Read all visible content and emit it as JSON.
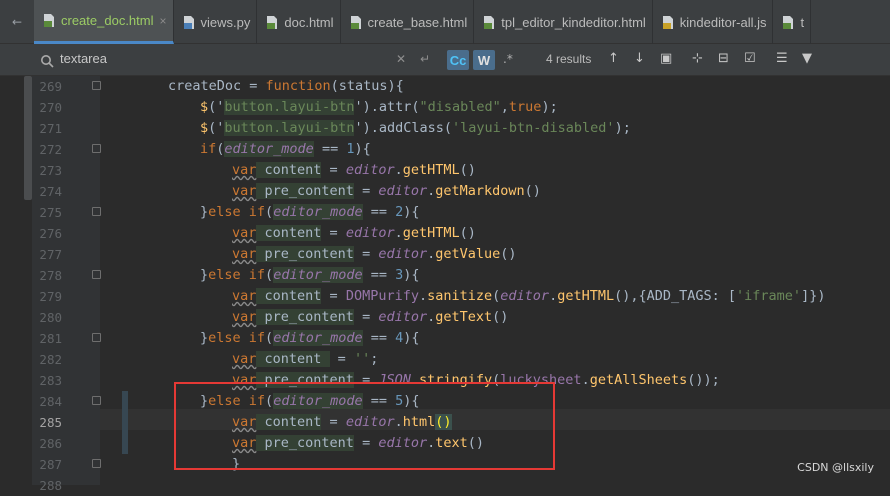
{
  "tabs": [
    {
      "label": "create_doc.html",
      "type": "html",
      "active": true,
      "closable": true
    },
    {
      "label": "views.py",
      "type": "py",
      "active": false,
      "closable": false
    },
    {
      "label": "doc.html",
      "type": "html",
      "active": false,
      "closable": false
    },
    {
      "label": "create_base.html",
      "type": "html",
      "active": false,
      "closable": false
    },
    {
      "label": "tpl_editor_kindeditor.html",
      "type": "html",
      "active": false,
      "closable": false
    },
    {
      "label": "kindeditor-all.js",
      "type": "js",
      "active": false,
      "closable": false
    },
    {
      "label": "t",
      "type": "html",
      "active": false,
      "closable": false
    }
  ],
  "find": {
    "query": "textarea",
    "match_case_label": "Cc",
    "words_label": "W",
    "regex_label": ".*",
    "results": "4 results"
  },
  "lines": [
    {
      "n": "269",
      "d": 0,
      "fold": true
    },
    {
      "n": "270",
      "d": 1
    },
    {
      "n": "271",
      "d": 1
    },
    {
      "n": "272",
      "d": 1,
      "fold": true
    },
    {
      "n": "273",
      "d": 2
    },
    {
      "n": "274",
      "d": 2
    },
    {
      "n": "275",
      "d": 1,
      "fold": true
    },
    {
      "n": "276",
      "d": 2
    },
    {
      "n": "277",
      "d": 2
    },
    {
      "n": "278",
      "d": 1,
      "fold": true
    },
    {
      "n": "279",
      "d": 2
    },
    {
      "n": "280",
      "d": 2
    },
    {
      "n": "281",
      "d": 1,
      "fold": true
    },
    {
      "n": "282",
      "d": 2
    },
    {
      "n": "283",
      "d": 2
    },
    {
      "n": "284",
      "d": 1,
      "fold": true,
      "changed": true
    },
    {
      "n": "285",
      "d": 2,
      "current": true,
      "changed": true
    },
    {
      "n": "286",
      "d": 2,
      "changed": true
    },
    {
      "n": "287",
      "d": 1,
      "fold": true
    },
    {
      "n": "288",
      "d": 1
    }
  ],
  "code": {
    "l269": {
      "id": "createDoc",
      "op": " = ",
      "kw": "function",
      "rest": "(status){"
    },
    "l270": {
      "jq": "$",
      "open": "('",
      "sel": "button.layui-btn",
      "close": "')",
      "call": ".attr(",
      "s1": "\"disabled\"",
      "comma": ",",
      "kw": "true",
      "end": ");"
    },
    "l271": {
      "jq": "$",
      "open": "('",
      "sel": "button.layui-btn",
      "close": "')",
      "call": ".addClass(",
      "s1": "'layui-btn-disabled'",
      "end": ");"
    },
    "l272": {
      "kw": "if",
      "open": "(",
      "v": "editor_mode",
      "op": " == ",
      "n": "1",
      "close": "){"
    },
    "l273": {
      "kw": "var",
      "id": " content",
      "op": " = ",
      "v": "editor",
      "dot": ".",
      "m": "getHTML",
      "end": "()"
    },
    "l274": {
      "kw": "var",
      "id": " pre_content",
      "op": " = ",
      "v": "editor",
      "dot": ".",
      "m": "getMarkdown",
      "end": "()"
    },
    "l275": {
      "pre": "}",
      "kw": "else if",
      "open": "(",
      "v": "editor_mode",
      "op": " == ",
      "n": "2",
      "close": "){"
    },
    "l276": {
      "kw": "var",
      "id": " content",
      "op": " = ",
      "v": "editor",
      "dot": ".",
      "m": "getHTML",
      "end": "()"
    },
    "l277": {
      "kw": "var",
      "id": " pre_content",
      "op": " = ",
      "v": "editor",
      "dot": ".",
      "m": "getValue",
      "end": "()"
    },
    "l278": {
      "pre": "}",
      "kw": "else if",
      "open": "(",
      "v": "editor_mode",
      "op": " == ",
      "n": "3",
      "close": "){"
    },
    "l279": {
      "kw": "var",
      "id": " content",
      "op": " = ",
      "obj": "DOMPurify",
      "dot": ".",
      "m": "sanitize",
      "p1": "(",
      "v": "editor",
      "dot2": ".",
      "m2": "getHTML",
      "p2": "(),{ADD_TAGS: [",
      "s": "'iframe'",
      "end": "]})"
    },
    "l280": {
      "kw": "var",
      "id": " pre_content",
      "op": " = ",
      "v": "editor",
      "dot": ".",
      "m": "getText",
      "end": "()"
    },
    "l281": {
      "pre": "}",
      "kw": "else if",
      "open": "(",
      "v": "editor_mode",
      "op": " == ",
      "n": "4",
      "close": "){"
    },
    "l282": {
      "kw": "var",
      "id": " content ",
      "op": " = ",
      "s": "''",
      "end": ";"
    },
    "l283": {
      "kw": "var",
      "id": " pre_content",
      "op": " = ",
      "v": "JSON",
      "dot": ".",
      "m": "stringify",
      "p1": "(",
      "obj": "luckysheet",
      "dot2": ".",
      "m2": "getAllSheets",
      "end": "());"
    },
    "l284": {
      "pre": "}",
      "kw": "else if",
      "open": "(",
      "v": "editor_mode",
      "op": " == ",
      "n": "5",
      "close": "){"
    },
    "l285": {
      "kw": "var",
      "id": " content",
      "op": " = ",
      "v": "editor",
      "dot": ".",
      "m": "html",
      "b": "()"
    },
    "l286": {
      "kw": "var",
      "id": " pre_content",
      "op": " = ",
      "v": "editor",
      "dot": ".",
      "m": "text",
      "end": "()"
    },
    "l287": {
      "pre": "}"
    }
  },
  "watermark": "CSDN @llsxily",
  "colors": {
    "accent_tab_underline": "#4a88c7",
    "annotation_box": "#e53935",
    "keyword": "#cc7832",
    "variable": "#9876aa",
    "method": "#ffc66d",
    "string": "#6a8759",
    "number": "#6897bb"
  }
}
